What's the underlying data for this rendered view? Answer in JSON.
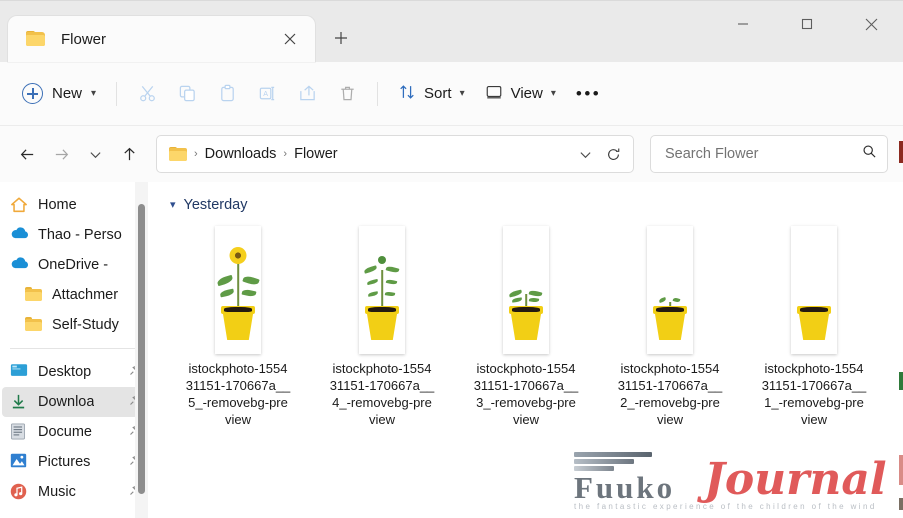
{
  "window": {
    "tab": {
      "title": "Flower",
      "folder_icon": "folder-icon",
      "close_icon": "close-icon"
    },
    "new_tab_icon": "plus-icon",
    "controls": {
      "minimize": "minimize-icon",
      "maximize": "maximize-icon",
      "close": "close-icon"
    }
  },
  "toolbar": {
    "new_label": "New",
    "new_icon": "plus-circle-icon",
    "new_chevron": "chevron-down-icon",
    "cut_icon": "scissors-icon",
    "copy_icon": "copy-icon",
    "paste_icon": "paste-icon",
    "rename_icon": "rename-icon",
    "share_icon": "share-icon",
    "delete_icon": "trash-icon",
    "sort_label": "Sort",
    "sort_icon": "sort-arrows-icon",
    "sort_chevron": "chevron-down-icon",
    "view_label": "View",
    "view_icon": "monitor-icon",
    "view_chevron": "chevron-down-icon",
    "more_label": "•••"
  },
  "nav": {
    "back_icon": "arrow-left-icon",
    "forward_icon": "arrow-right-icon",
    "recent_icon": "chevron-down-icon",
    "up_icon": "arrow-up-icon"
  },
  "address": {
    "folder_icon": "folder-icon",
    "crumbs": [
      "Downloads",
      "Flower"
    ],
    "separator": "›",
    "dropdown_icon": "chevron-down-icon",
    "refresh_icon": "refresh-icon"
  },
  "search": {
    "placeholder": "Search Flower",
    "icon": "search-icon"
  },
  "sidebar": {
    "items": [
      {
        "label": "Home",
        "icon": "home-icon",
        "indent": false,
        "selected": false,
        "pinned": false
      },
      {
        "label": "Thao - Perso",
        "icon": "onedrive-cloud-icon",
        "indent": false,
        "selected": false,
        "pinned": false
      },
      {
        "label": "OneDrive -",
        "icon": "onedrive-cloud-icon",
        "indent": false,
        "selected": false,
        "pinned": false
      },
      {
        "label": "Attachmer",
        "icon": "folder-icon",
        "indent": true,
        "selected": false,
        "pinned": false
      },
      {
        "label": "Self-Study",
        "icon": "folder-icon",
        "indent": true,
        "selected": false,
        "pinned": false
      },
      {
        "label": "Desktop",
        "icon": "desktop-icon",
        "indent": false,
        "selected": false,
        "pinned": true
      },
      {
        "label": "Downloa",
        "icon": "downloads-icon",
        "indent": false,
        "selected": true,
        "pinned": true
      },
      {
        "label": "Docume",
        "icon": "documents-icon",
        "indent": false,
        "selected": false,
        "pinned": true
      },
      {
        "label": "Pictures",
        "icon": "pictures-icon",
        "indent": false,
        "selected": false,
        "pinned": true
      },
      {
        "label": "Music",
        "icon": "music-icon",
        "indent": false,
        "selected": false,
        "pinned": true
      }
    ],
    "separator_after_index": 4,
    "pin_icon": "pin-icon",
    "scrollbar": "vertical-scrollbar"
  },
  "content": {
    "group": {
      "label": "Yesterday",
      "chevron": "chevron-down-icon"
    },
    "files": [
      {
        "name_lines": [
          "istockphoto-1554",
          "31151-170667a__",
          "5_-removebg-pre",
          "view"
        ],
        "full_name": "istockphoto-155431151-170667a__5_-removebg-preview",
        "stage": 5
      },
      {
        "name_lines": [
          "istockphoto-1554",
          "31151-170667a__",
          "4_-removebg-pre",
          "view"
        ],
        "full_name": "istockphoto-155431151-170667a__4_-removebg-preview",
        "stage": 4
      },
      {
        "name_lines": [
          "istockphoto-1554",
          "31151-170667a__",
          "3_-removebg-pre",
          "view"
        ],
        "full_name": "istockphoto-155431151-170667a__3_-removebg-preview",
        "stage": 3
      },
      {
        "name_lines": [
          "istockphoto-1554",
          "31151-170667a__",
          "2_-removebg-pre",
          "view"
        ],
        "full_name": "istockphoto-155431151-170667a__2_-removebg-preview",
        "stage": 2
      },
      {
        "name_lines": [
          "istockphoto-1554",
          "31151-170667a__",
          "1_-removebg-pre",
          "view"
        ],
        "full_name": "istockphoto-155431151-170667a__1_-removebg-preview",
        "stage": 1
      }
    ]
  },
  "watermark": {
    "brand_left": "Fuuko",
    "brand_right": "Journal",
    "tagline": "the fantastic experience of the children of the wind"
  },
  "colors": {
    "accent_blue": "#3b6fb6",
    "folder_yellow": "#fcd66a",
    "selection_gray": "#e4e4e4",
    "group_header_blue": "#203864",
    "watermark_red": "#e05a5a"
  }
}
